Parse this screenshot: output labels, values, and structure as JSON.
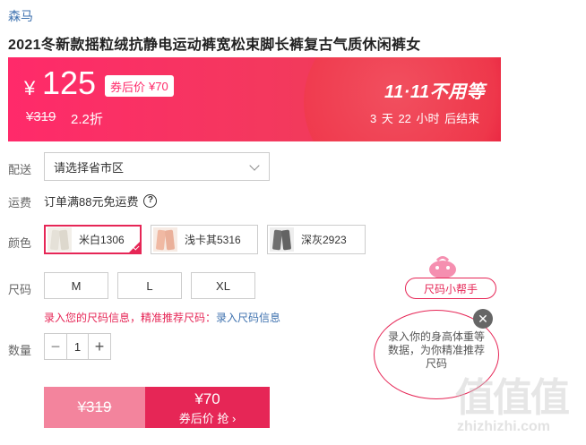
{
  "brand": "森马",
  "title": "2021冬新款摇粒绒抗静电运动裤宽松束脚长裤复古气质休闲裤女",
  "price_bar": {
    "currency": "¥",
    "price": "125",
    "coupon_label": "券后价",
    "coupon_price": "¥70",
    "original_price": "¥319",
    "discount": "2.2折",
    "event": "11·11不用等",
    "countdown": "3 天 22 小时 后结束",
    "colors": {
      "start": "#ff2a6a",
      "end": "#e8213f"
    }
  },
  "delivery": {
    "label": "配送",
    "placeholder": "请选择省市区"
  },
  "shipping": {
    "label": "运费",
    "text": "订单满88元免运费"
  },
  "colors": {
    "label": "颜色",
    "options": [
      {
        "name": "米白1306",
        "selected": true
      },
      {
        "name": "浅卡其5316",
        "selected": false
      },
      {
        "name": "深灰2923",
        "selected": false
      }
    ]
  },
  "sizes": {
    "label": "尺码",
    "options": [
      "M",
      "L",
      "XL"
    ]
  },
  "size_tip": {
    "text": "录入您的尺码信息，精准推荐尺码：",
    "link": "录入尺码信息"
  },
  "quantity": {
    "label": "数量",
    "value": "1",
    "minus": "−",
    "plus": "+"
  },
  "buy": {
    "original": "¥319",
    "coupon_price": "¥70",
    "coupon_action": "券后价 抢 ›",
    "accent": "#e62656"
  },
  "helper": {
    "pill": "尺码小帮手",
    "bubble_text": "录入你的身高体重等数据，为你精准推荐尺码",
    "close": "✕"
  },
  "watermark": {
    "logo": "值值值",
    "text": "zhizhizhi.com"
  }
}
